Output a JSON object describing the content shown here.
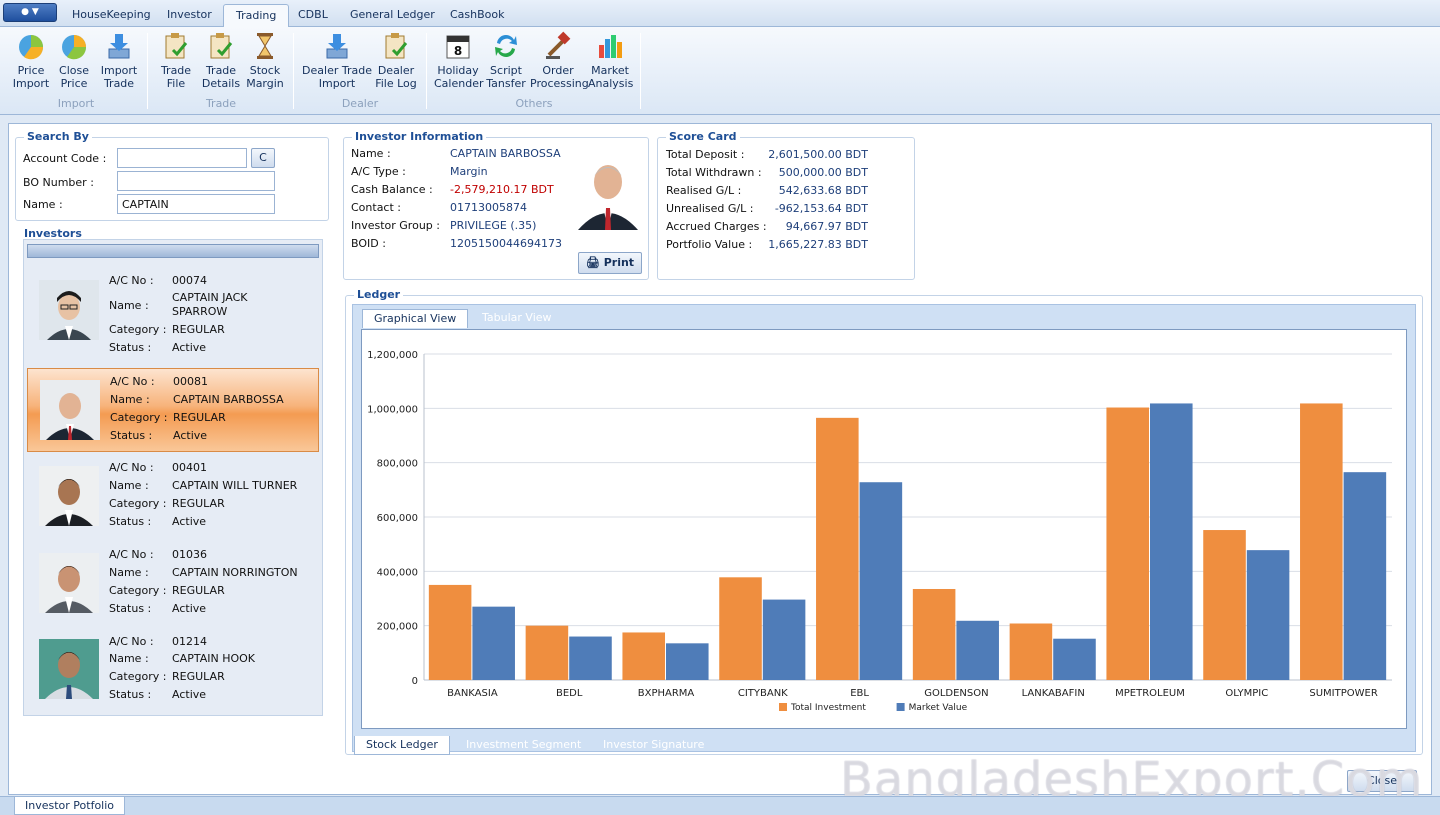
{
  "tabs": [
    "HouseKeeping",
    "Investor",
    "Trading",
    "CDBL",
    "General Ledger",
    "CashBook"
  ],
  "active_tab": "Trading",
  "ribbon": {
    "groups": [
      {
        "label": "Import",
        "buttons": [
          {
            "label": "Price\nImport",
            "icon": "price-import-icon"
          },
          {
            "label": "Close\nPrice",
            "icon": "close-price-icon"
          },
          {
            "label": "Import\nTrade",
            "icon": "import-trade-icon"
          }
        ]
      },
      {
        "label": "Trade",
        "buttons": [
          {
            "label": "Trade\nFile",
            "icon": "trade-file-icon"
          },
          {
            "label": "Trade\nDetails",
            "icon": "trade-details-icon"
          },
          {
            "label": "Stock\nMargin",
            "icon": "stock-margin-icon"
          }
        ]
      },
      {
        "label": "Dealer",
        "buttons": [
          {
            "label": "Dealer Trade\nImport",
            "icon": "dealer-trade-import-icon"
          },
          {
            "label": "Dealer\nFile Log",
            "icon": "dealer-file-log-icon"
          }
        ]
      },
      {
        "label": "Others",
        "buttons": [
          {
            "label": "Holiday\nCalender",
            "icon": "calendar-icon"
          },
          {
            "label": "Script\nTansfer",
            "icon": "script-transfer-icon"
          },
          {
            "label": "Order\nProcessing",
            "icon": "order-processing-icon"
          },
          {
            "label": "Market\nAnalysis",
            "icon": "market-analysis-icon"
          }
        ]
      }
    ],
    "calendar_day": "8"
  },
  "search": {
    "title": "Search By",
    "account_code_label": "Account Code :",
    "account_code_value": "",
    "c_button": "C",
    "bo_number_label": "BO Number :",
    "bo_number_value": "",
    "name_label": "Name :",
    "name_value": "CAPTAIN"
  },
  "investors": {
    "title": "Investors",
    "labels": {
      "ac": "A/C No :",
      "name": "Name :",
      "category": "Category :",
      "status": "Status :"
    },
    "items": [
      {
        "ac": "00074",
        "name": "CAPTAIN JACK SPARROW",
        "category": "REGULAR",
        "status": "Active"
      },
      {
        "ac": "00081",
        "name": "CAPTAIN BARBOSSA",
        "category": "REGULAR",
        "status": "Active"
      },
      {
        "ac": "00401",
        "name": "CAPTAIN WILL TURNER",
        "category": "REGULAR",
        "status": "Active"
      },
      {
        "ac": "01036",
        "name": "CAPTAIN NORRINGTON",
        "category": "REGULAR",
        "status": "Active"
      },
      {
        "ac": "01214",
        "name": "CAPTAIN HOOK",
        "category": "REGULAR",
        "status": "Active"
      }
    ]
  },
  "investor_info": {
    "title": "Investor Information",
    "fields": [
      {
        "label": "Name :",
        "value": "CAPTAIN BARBOSSA"
      },
      {
        "label": "A/C Type :",
        "value": "Margin"
      },
      {
        "label": "Cash Balance :",
        "value": "-2,579,210.17 BDT"
      },
      {
        "label": "Contact :",
        "value": "01713005874"
      },
      {
        "label": "Investor Group :",
        "value": "PRIVILEGE (.35)"
      },
      {
        "label": "BOID :",
        "value": "1205150044694173"
      }
    ],
    "print_label": "Print"
  },
  "score_card": {
    "title": "Score Card",
    "fields": [
      {
        "label": "Total Deposit :",
        "value": "2,601,500.00 BDT"
      },
      {
        "label": "Total Withdrawn :",
        "value": "500,000.00 BDT"
      },
      {
        "label": "Realised G/L :",
        "value": "542,633.68 BDT"
      },
      {
        "label": "Unrealised G/L :",
        "value": "-962,153.64 BDT"
      },
      {
        "label": "Accrued Charges :",
        "value": "94,667.97 BDT"
      },
      {
        "label": "Portfolio Value :",
        "value": "1,665,227.83 BDT"
      }
    ]
  },
  "ledger": {
    "title": "Ledger",
    "view_tabs": [
      "Graphical View",
      "Tabular View"
    ],
    "bottom_tabs": [
      "Stock Ledger",
      "Investment Segment",
      "Investor Signature"
    ]
  },
  "chart_data": {
    "type": "bar",
    "categories": [
      "BANKASIA",
      "BEDL",
      "BXPHARMA",
      "CITYBANK",
      "EBL",
      "GOLDENSON",
      "LANKABAFIN",
      "MPETROLEUM",
      "OLYMPIC",
      "SUMITPOWER"
    ],
    "series": [
      {
        "name": "Total Investment",
        "color": "#ef8e3f",
        "values": [
          350000,
          200000,
          175000,
          378000,
          965000,
          335000,
          208000,
          1003000,
          552000,
          1018000
        ]
      },
      {
        "name": "Market Value",
        "color": "#4f7cb8",
        "values": [
          270000,
          160000,
          135000,
          296000,
          728000,
          218000,
          152000,
          1018000,
          478000,
          765000
        ]
      }
    ],
    "ylim": [
      0,
      1200000
    ],
    "yticks": [
      0,
      200000,
      400000,
      600000,
      800000,
      1000000,
      1200000
    ],
    "ytick_labels": [
      "0",
      "200,000",
      "400,000",
      "600,000",
      "800,000",
      "1,000,000",
      "1,200,000"
    ],
    "grid": true,
    "legend": "bottom-center",
    "title": "",
    "xlabel": "",
    "ylabel": ""
  },
  "close_label": "Close",
  "status_tab": "Investor Potfolio",
  "watermark": "BangladeshExport.Com"
}
